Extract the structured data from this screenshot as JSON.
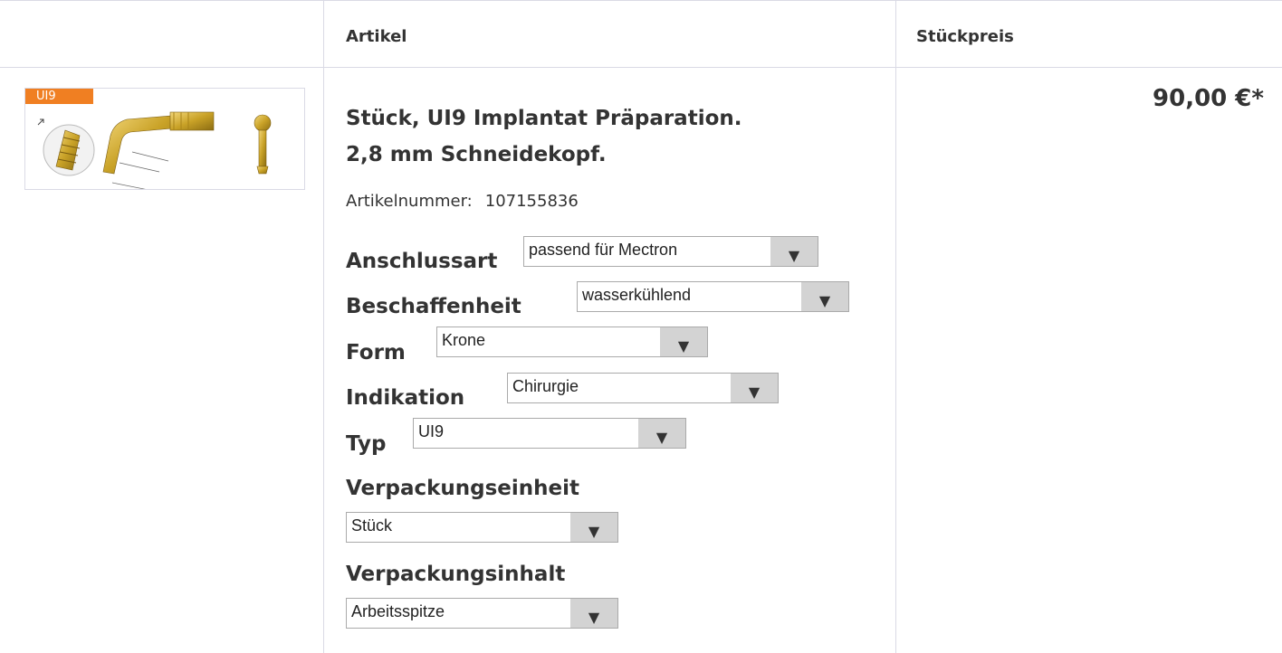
{
  "table": {
    "headers": {
      "artikel": "Artikel",
      "stueckpreis": "Stückpreis"
    }
  },
  "product": {
    "badge": "UI9",
    "title_line1": "Stück, UI9 Implantat Präparation.",
    "title_line2": "2,8 mm Schneidekopf.",
    "artnr_label": "Artikelnummer:",
    "artnr_value": "107155836",
    "price": "90,00 €*"
  },
  "options": [
    {
      "label": "Anschlussart",
      "value": "passend für Mectron"
    },
    {
      "label": "Beschaffenheit",
      "value": "wasserkühlend"
    },
    {
      "label": "Form",
      "value": "Krone"
    },
    {
      "label": "Indikation",
      "value": "Chirurgie"
    },
    {
      "label": "Typ",
      "value": "UI9"
    },
    {
      "label": "Verpackungseinheit",
      "value": "Stück"
    },
    {
      "label": "Verpackungsinhalt",
      "value": "Arbeitsspitze"
    }
  ],
  "icons": {
    "dropdown": "triangle-down-icon"
  },
  "colors": {
    "badge": "#f07f22",
    "border": "#dadae5",
    "arrow_bg": "#d3d3d3",
    "gold": "#c9a227"
  }
}
